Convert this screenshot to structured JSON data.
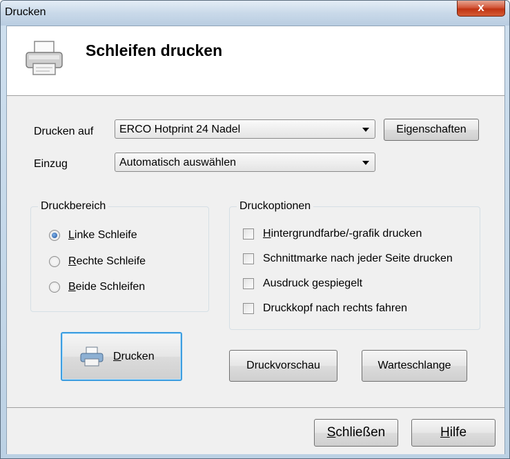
{
  "window": {
    "title": "Drucken",
    "close_label": "x"
  },
  "header": {
    "title": "Schleifen drucken",
    "icon": "printer-icon"
  },
  "print_on": {
    "label": "Drucken auf",
    "value": "ERCO Hotprint 24 Nadel",
    "properties_button": "Eigenschaften"
  },
  "feed": {
    "label": "Einzug",
    "value": "Automatisch auswählen"
  },
  "print_range": {
    "title": "Druckbereich",
    "options": [
      {
        "label": "Linke Schleife",
        "accel": "L",
        "rest": "inke Schleife",
        "checked": true
      },
      {
        "label": "Rechte Schleife",
        "accel": "R",
        "rest": "echte Schleife",
        "checked": false
      },
      {
        "label": "Beide Schleifen",
        "accel": "B",
        "rest": "eide Schleifen",
        "checked": false
      }
    ]
  },
  "print_options": {
    "title": "Druckoptionen",
    "options": [
      {
        "label": "Hintergrundfarbe/-grafik drucken",
        "accel": "H",
        "rest": "intergrundfarbe/-grafik drucken",
        "checked": false
      },
      {
        "label": "Schnittmarke nach jeder Seite drucken",
        "accel": "",
        "rest": "Schnittmarke nach jeder Seite drucken",
        "checked": false
      },
      {
        "label": "Ausdruck gespiegelt",
        "accel": "",
        "rest": "Ausdruck gespiegelt",
        "checked": false
      },
      {
        "label": "Druckkopf nach rechts fahren",
        "accel": "",
        "rest": "Druckkopf nach rechts fahren",
        "checked": false
      }
    ]
  },
  "actions": {
    "print": {
      "accel": "D",
      "rest": "rucken"
    },
    "preview": "Druckvorschau",
    "queue": "Warteschlange"
  },
  "footer": {
    "close": {
      "accel": "S",
      "rest": "chließen"
    },
    "help": {
      "accel": "H",
      "rest": "ilfe"
    }
  }
}
